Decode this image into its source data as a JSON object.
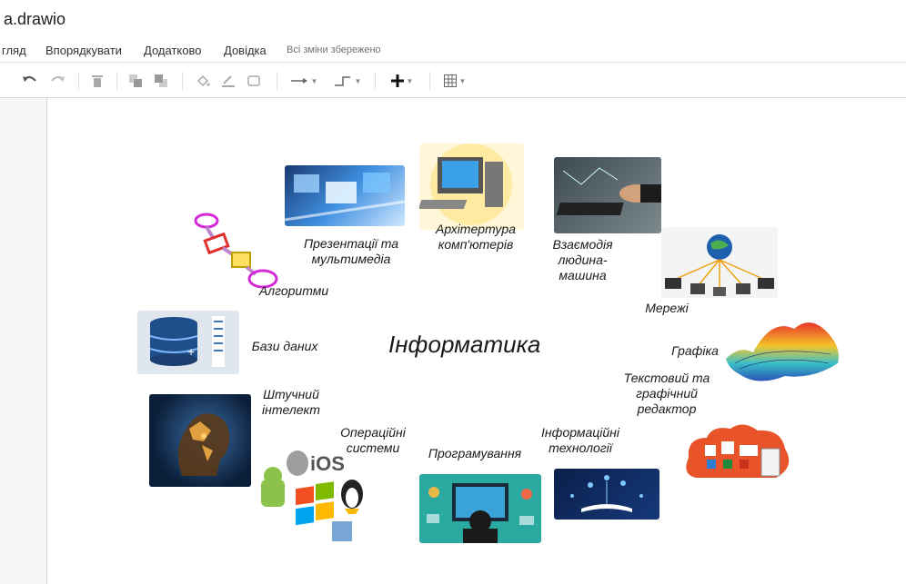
{
  "window": {
    "title": "a.drawio"
  },
  "menu": {
    "items": [
      "гляд",
      "Впорядкувати",
      "Додатково",
      "Довідка"
    ],
    "save_status": "Всі зміни збережено"
  },
  "toolbar": {
    "tools": [
      "undo-icon",
      "redo-icon",
      "delete-icon",
      "to-front-icon",
      "to-back-icon",
      "fill-color-icon",
      "line-color-icon",
      "shadow-icon",
      "connection-icon",
      "waypoints-icon",
      "insert-icon",
      "table-icon"
    ]
  },
  "diagram": {
    "center": "Інформатика",
    "topics": {
      "presentations": "Презентації та|мультимедіа",
      "architecture": "Архітертура|комп'ютерів",
      "interaction": "Взаємодія|людина-|машина",
      "algorithms": "Алгоритми",
      "networks": "Мережі",
      "databases": "Бази даних",
      "graphics": "Графіка",
      "editors": "Текстовий та|графічний|редактор",
      "ai": "Штучний|інтелект",
      "os": "Операційні|системи",
      "it": "Інформаційні|технології",
      "programming": "Програмування"
    }
  },
  "colors": {
    "accent": "#1565c0",
    "icon": "#707070"
  }
}
